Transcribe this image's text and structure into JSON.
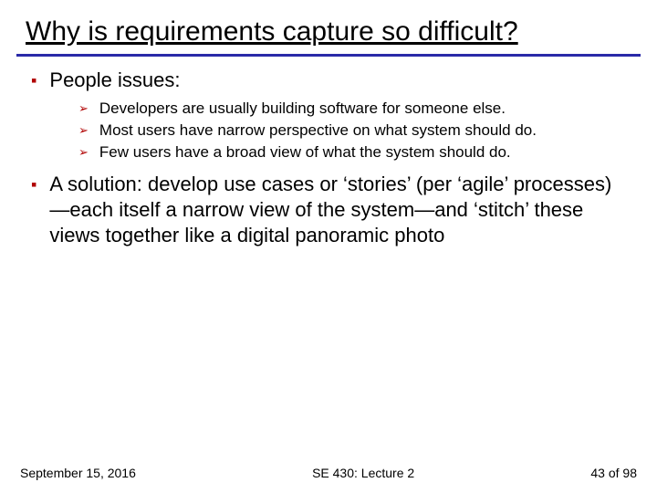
{
  "title": "Why is requirements capture so difficult?",
  "bullets": [
    {
      "text": "People issues:",
      "sub": [
        "Developers are usually building software for someone else.",
        "Most users have narrow perspective on what system should do.",
        "Few users have a broad view of what the system should do."
      ]
    },
    {
      "text": "A solution: develop use cases or ‘stories’ (per ‘agile’ processes)—each itself a narrow view of the system—and ‘stitch’ these views together like a digital panoramic photo",
      "sub": []
    }
  ],
  "footer": {
    "date": "September 15, 2016",
    "course": "SE 430: Lecture 2",
    "page_current": "43",
    "page_of": " of ",
    "page_total": "98"
  },
  "markers": {
    "l1": "▪",
    "l2": "➢"
  }
}
